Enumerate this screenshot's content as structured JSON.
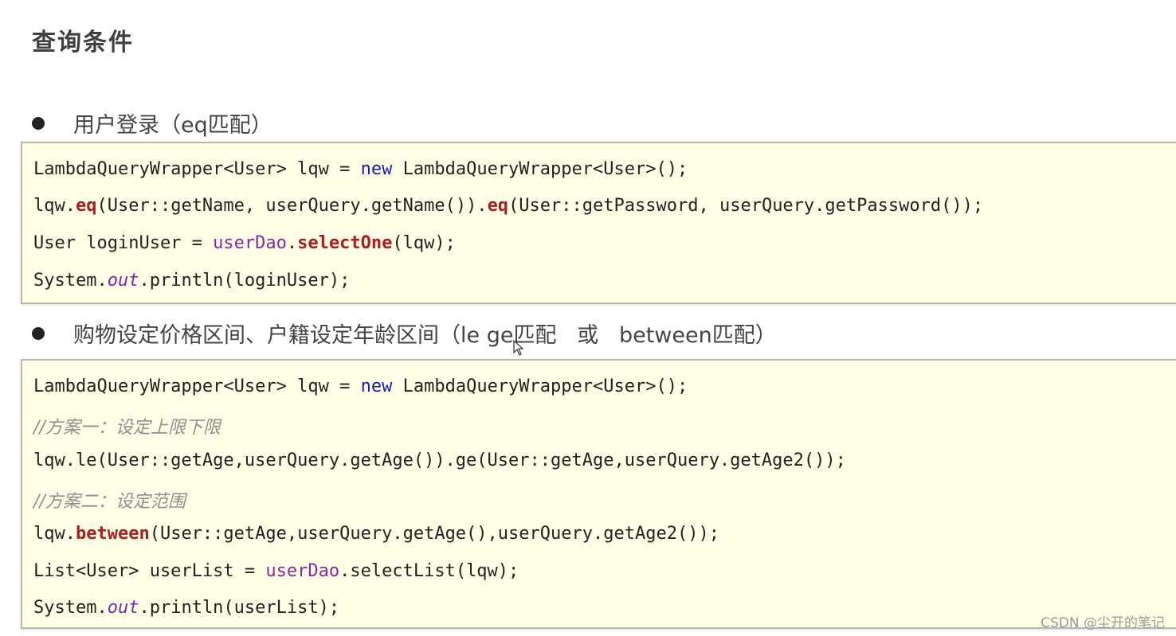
{
  "title": "查询条件",
  "section1": {
    "heading": "用户登录（eq匹配）",
    "code": {
      "l1_a": "LambdaQueryWrapper<User> lqw = ",
      "l1_new": "new",
      "l1_b": " LambdaQueryWrapper<User>();",
      "l2_a": "lqw.",
      "l2_eq1": "eq",
      "l2_b": "(User::getName, userQuery.getName()).",
      "l2_eq2": "eq",
      "l2_c": "(User::getPassword, userQuery.getPassword());",
      "l3_a": "User loginUser = ",
      "l3_dao": "userDao",
      "l3_dot": ".",
      "l3_sel": "selectOne",
      "l3_b": "(lqw);",
      "l4_a": "System.",
      "l4_out": "out",
      "l4_b": ".println(loginUser);"
    }
  },
  "section2": {
    "heading": "购物设定价格区间、户籍设定年龄区间（le ge匹配   或   between匹配）",
    "code": {
      "l1_a": "LambdaQueryWrapper<User> lqw = ",
      "l1_new": "new",
      "l1_b": " LambdaQueryWrapper<User>();",
      "c1": "//方案一：设定上限下限",
      "l2": "lqw.le(User::getAge,userQuery.getAge()).ge(User::getAge,userQuery.getAge2());",
      "c2": "//方案二：设定范围",
      "l3_a": "lqw.",
      "l3_btw": "between",
      "l3_b": "(User::getAge,userQuery.getAge(),userQuery.getAge2());",
      "l4_a": "List<User> userList = ",
      "l4_dao": "userDao",
      "l4_b": ".selectList(lqw);",
      "l5_a": "System.",
      "l5_out": "out",
      "l5_b": ".println(userList);"
    }
  },
  "watermark": "CSDN @尘开的笔记",
  "icons": {
    "bullet": "bullet-dot-icon",
    "cursor": "mouse-pointer-icon"
  }
}
